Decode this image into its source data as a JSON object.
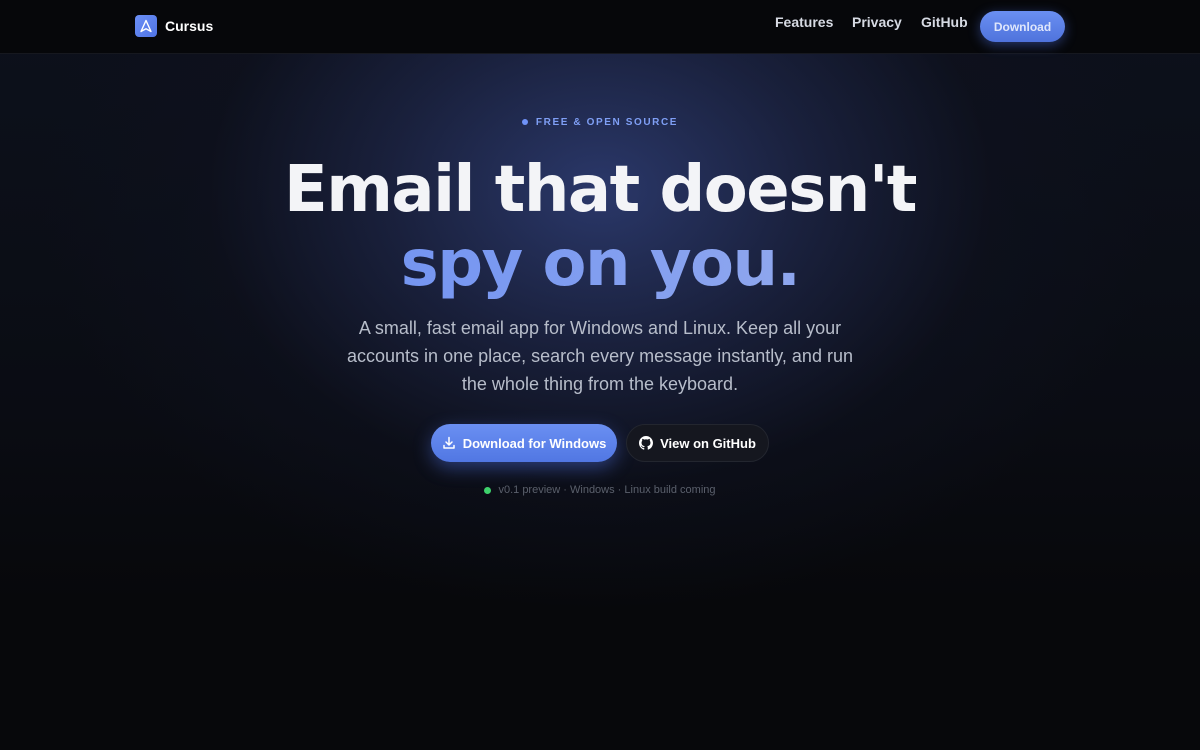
{
  "brand": {
    "name": "Cursus",
    "logo_icon": "compass-a-icon"
  },
  "nav": {
    "links": [
      "Features",
      "Privacy",
      "GitHub"
    ],
    "download_label": "Download"
  },
  "hero": {
    "eyebrow": "FREE & OPEN SOURCE",
    "headline_line1": "Email that doesn't",
    "headline_line2": "spy on you.",
    "subtitle": "A small, fast email app for Windows and Linux. Keep all your accounts in one place, search every message instantly, and run the whole thing from the keyboard.",
    "primary_button": {
      "label": "Download for Windows",
      "icon": "download-icon"
    },
    "secondary_button": {
      "label": "View on GitHub",
      "icon": "github-icon"
    },
    "status": {
      "text": "v0.1 preview · Windows · Linux build coming",
      "color": "#3ed16b"
    }
  },
  "colors": {
    "accent": "#5b80ec",
    "background": "#07080b",
    "heading": "#f3f4f7"
  }
}
